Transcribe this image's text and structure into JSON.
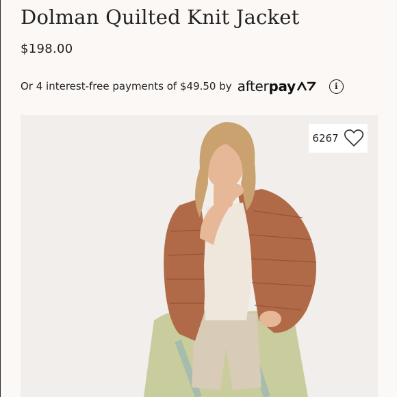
{
  "product": {
    "title": "Dolman Quilted Knit Jacket",
    "price": "$198.00"
  },
  "afterpay": {
    "text": "Or 4 interest-free payments of $49.50 by",
    "brand_light": "after",
    "brand_bold": "pay",
    "info_icon": "info-icon",
    "info_glyph": "i"
  },
  "likes": {
    "count": "6267",
    "icon": "heart-outline-icon"
  },
  "image": {
    "subject": "model-wearing-jacket",
    "colors": {
      "background": "#f1eeeb",
      "jacket": "#b06a48",
      "top": "#efe6dc",
      "shorts": "#d8cbb8",
      "hair": "#c9a270",
      "skin": "#e6b898",
      "tied_shirt": "#c9cc9c"
    }
  }
}
